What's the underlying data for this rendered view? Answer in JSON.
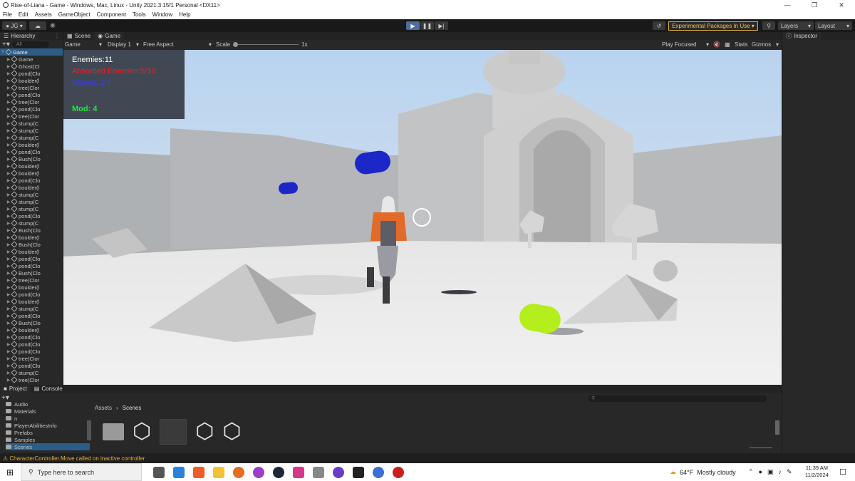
{
  "window": {
    "title": "Rise-of-Liana - Game - Windows, Mac, Linux - Unity 2021.3.15f1 Personal <DX11>"
  },
  "menu": [
    "File",
    "Edit",
    "Assets",
    "GameObject",
    "Component",
    "Tools",
    "Window",
    "Help"
  ],
  "toolbar": {
    "account": "JG",
    "experimental": "Experimental Packages In Use",
    "layers": "Layers",
    "layout": "Layout"
  },
  "hierarchy": {
    "tab": "Hierarchy",
    "search_placeholder": "All",
    "root": "Game",
    "items": [
      "Game",
      "Ghost(Cl",
      "pond(Clo",
      "boulder(l",
      "tree(Clor",
      "pond(Clo",
      "tree(Clor",
      "pond(Clo",
      "tree(Clor",
      "stump(C",
      "stump(C",
      "stump(C",
      "boulder(l",
      "pond(Clo",
      "Bush(Clo",
      "boulder(l",
      "boulder(l",
      "pond(Clo",
      "boulder(l",
      "stump(C",
      "stump(C",
      "stump(C",
      "pond(Clo",
      "stump(C",
      "Bush(Clo",
      "boulder(l",
      "Bush(Clo",
      "boulder(l",
      "pond(Clo",
      "pond(Clo",
      "Bush(Clo",
      "tree(Clor",
      "boulder(l",
      "pond(Clo",
      "boulder(l",
      "stump(C",
      "pond(Clo",
      "Bush(Clo",
      "boulder(l",
      "pond(Clo",
      "pond(Clo",
      "pond(Clo",
      "tree(Clor",
      "pond(Clo",
      "stump(C",
      "tree(Clor"
    ]
  },
  "view_tabs": {
    "scene": "Scene",
    "game": "Game"
  },
  "gamebar": {
    "mode": "Game",
    "display": "Display 1",
    "aspect": "Free Aspect",
    "scale_label": "Scale",
    "scale_value": "1x",
    "play_focused": "Play Focused",
    "stats": "Stats",
    "gizmos": "Gizmos"
  },
  "hud": {
    "enemies": "Enemies:11",
    "absorbed": "Absorbed Enemies:5/10",
    "waves": "Waves: 1/4",
    "mod": "Mod: 4"
  },
  "inspector": {
    "tab": "Inspector"
  },
  "project": {
    "tab_project": "Project",
    "tab_console": "Console",
    "folders": [
      "Audio",
      "Materials",
      "n",
      "PlayerAbilitiesInfo",
      "Prefabs",
      "Samples",
      "Scenes"
    ],
    "breadcrumb": [
      "Assets",
      "Scenes"
    ]
  },
  "console": {
    "message": "CharacterController.Move called on inactive controller"
  },
  "taskbar": {
    "search": "Type here to search",
    "weather_temp": "64°F",
    "weather_desc": "Mostly cloudy",
    "time": "11:39 AM",
    "date": "11/2/2024"
  },
  "colors": {
    "hud_enemies": "#ffffff",
    "hud_absorbed": "#e4232b",
    "hud_waves": "#3a3de6",
    "hud_mod": "#22e83a",
    "accent": "#4f6e9e"
  }
}
